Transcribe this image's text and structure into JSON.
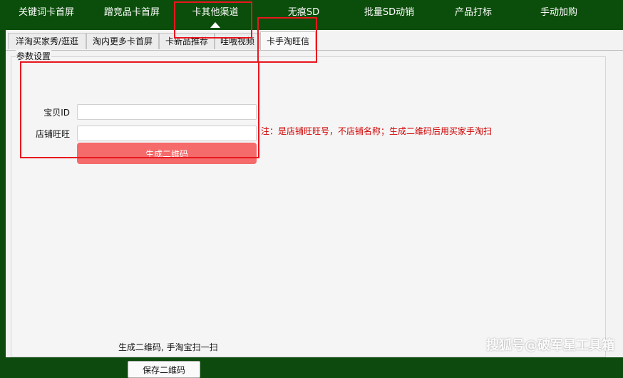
{
  "top_nav": {
    "items": [
      {
        "label": "关键词卡首屏"
      },
      {
        "label": "蹭竞品卡首屏"
      },
      {
        "label": "卡其他渠道"
      },
      {
        "label": "无痕SD"
      },
      {
        "label": "批量SD动销"
      },
      {
        "label": "产品打标"
      },
      {
        "label": "手动加购"
      }
    ],
    "active_index": 2
  },
  "sub_tabs": {
    "items": [
      {
        "label": "洋淘买家秀/逛逛"
      },
      {
        "label": "淘内更多卡首屏"
      },
      {
        "label": "卡新品推荐"
      },
      {
        "label": "哇哦视频"
      },
      {
        "label": "卡手淘旺信"
      }
    ],
    "active_index": 4
  },
  "form": {
    "group_label": "参数设置",
    "item_id_label": "宝贝ID",
    "item_id_value": "",
    "shop_wangwang_label": "店铺旺旺",
    "shop_wangwang_value": "",
    "generate_button": "生成二维码",
    "note": "注：是店铺旺旺号，不店铺名称；生成二维码后用买家手淘扫"
  },
  "qr": {
    "caption": "生成二维码, 手淘宝扫一扫",
    "save_button": "保存二维码"
  },
  "watermark": "搜狐号@破军星工具箱",
  "colors": {
    "nav_background": "#0b4e0b",
    "generate_button": "#f56a6a",
    "note_text": "#d10000",
    "annotation_box": "#e8161e"
  }
}
